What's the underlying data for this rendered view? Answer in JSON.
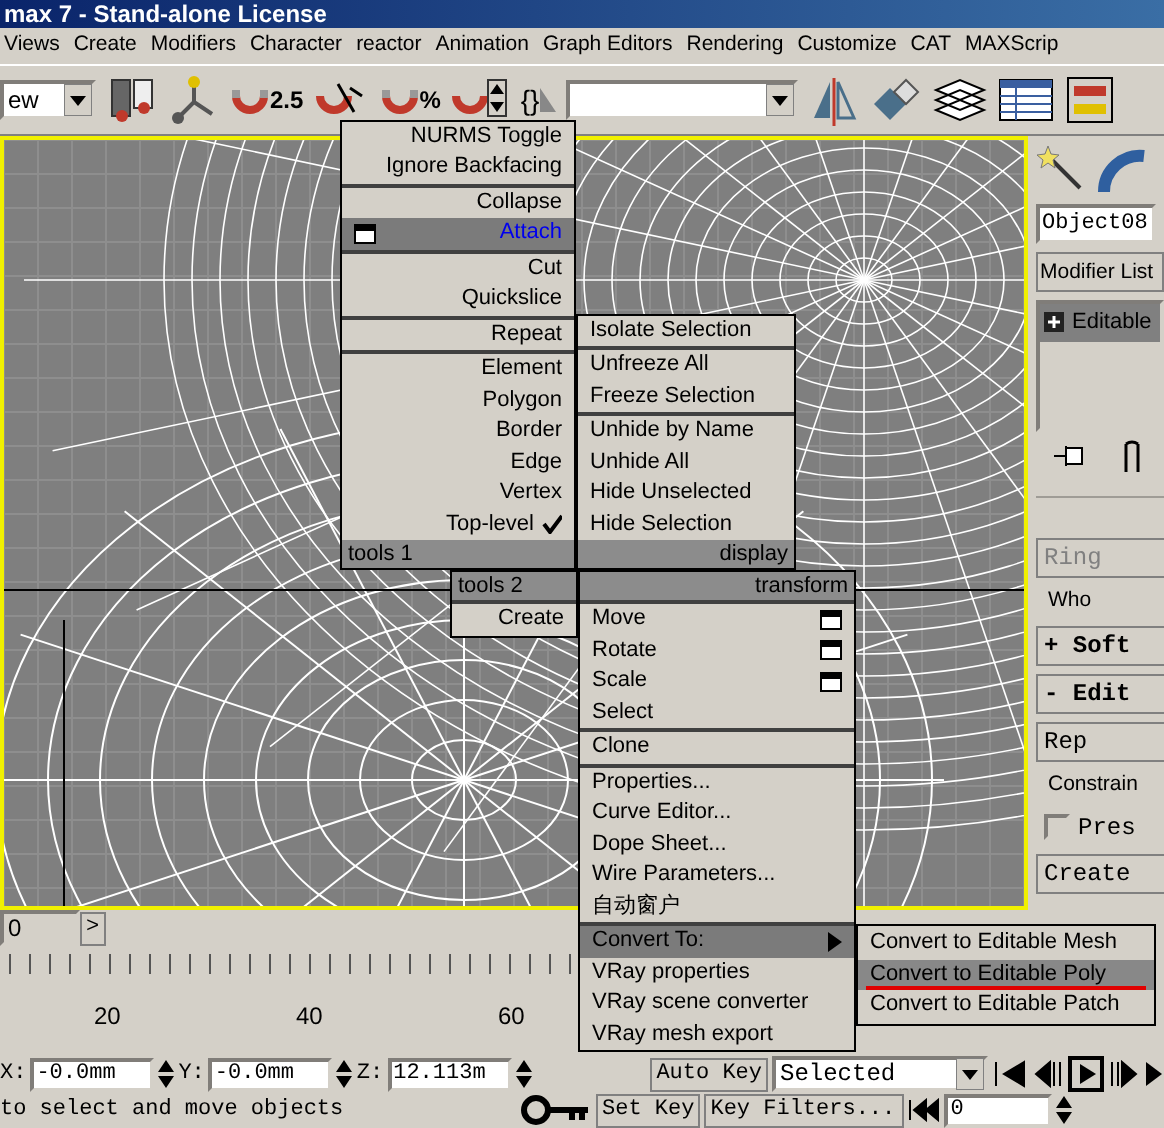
{
  "window": {
    "title": "max 7  - Stand-alone License"
  },
  "menu_bar": [
    "Views",
    "Create",
    "Modifiers",
    "Character",
    "reactor",
    "Animation",
    "Graph Editors",
    "Rendering",
    "Customize",
    "CAT",
    "MAXScrip"
  ],
  "toolbar": [
    {
      "kind": "dropdown",
      "value": "ew"
    },
    {
      "kind": "link"
    },
    {
      "kind": "axis"
    },
    {
      "kind": "snap",
      "label": "2.5"
    },
    {
      "kind": "angle-snap"
    },
    {
      "kind": "snap",
      "label": "%"
    },
    {
      "kind": "spinner-snap"
    },
    {
      "kind": "sets",
      "label": "{}"
    },
    {
      "kind": "combo"
    },
    {
      "kind": "mirror"
    },
    {
      "kind": "align"
    },
    {
      "kind": "layers"
    },
    {
      "kind": "table"
    },
    {
      "kind": "schematic"
    }
  ],
  "command_panel": {
    "tabs": [
      {
        "kind": "create"
      },
      {
        "kind": "modify"
      }
    ],
    "object_name": "Object08",
    "modifier_list": "Modifier List",
    "stack": [
      {
        "label": "Editable",
        "selected": true
      }
    ],
    "controls": [
      {
        "kind": "button",
        "label": "Ring",
        "disabled": true
      },
      {
        "kind": "text",
        "label": "Who"
      },
      {
        "kind": "rollout",
        "sign": "+",
        "label": "Soft"
      },
      {
        "kind": "rollout",
        "sign": "-",
        "label": "Edit"
      },
      {
        "kind": "button",
        "label": "Rep",
        "disabled": false
      },
      {
        "kind": "text",
        "label": "Constrain"
      },
      {
        "kind": "checkbox",
        "label": "Pres",
        "checked": false
      },
      {
        "kind": "button",
        "label": "Create",
        "disabled": false
      }
    ]
  },
  "time_slider": {
    "value": "0",
    "next": ">"
  },
  "ruler": {
    "labels": [
      "20",
      "40",
      "60"
    ]
  },
  "coordinates": [
    {
      "axis": "X:",
      "value": "-0.0mm"
    },
    {
      "axis": "Y:",
      "value": "-0.0mm"
    },
    {
      "axis": "Z:",
      "value": "12.113m"
    }
  ],
  "animation": {
    "auto_key": "Auto Key",
    "key_mode": "Selected",
    "set_key": "Set Key",
    "key_filters": "Key Filters...",
    "frame": "0"
  },
  "prompt": "to select and move objects",
  "quad_menu": {
    "quadrants": [
      {
        "title": "tools 1",
        "groups": [
          [
            {
              "label": "NURMS Toggle",
              "kind": "plain",
              "selected": false,
              "checked": false
            },
            {
              "label": "Ignore Backfacing",
              "kind": "plain",
              "selected": false,
              "checked": false
            }
          ],
          [
            {
              "label": "Collapse",
              "kind": "plain",
              "selected": false,
              "checked": false
            },
            {
              "label": "Attach",
              "kind": "options",
              "selected": true,
              "checked": false
            }
          ],
          [
            {
              "label": "Cut",
              "kind": "plain",
              "selected": false,
              "checked": false
            },
            {
              "label": "Quickslice",
              "kind": "plain",
              "selected": false,
              "checked": false
            }
          ],
          [
            {
              "label": "Repeat",
              "kind": "plain",
              "selected": false,
              "checked": false
            }
          ],
          [
            {
              "label": "Element",
              "kind": "plain",
              "selected": false,
              "checked": false
            },
            {
              "label": "Polygon",
              "kind": "plain",
              "selected": false,
              "checked": false
            },
            {
              "label": "Border",
              "kind": "plain",
              "selected": false,
              "checked": false
            },
            {
              "label": "Edge",
              "kind": "plain",
              "selected": false,
              "checked": false
            },
            {
              "label": "Vertex",
              "kind": "plain",
              "selected": false,
              "checked": false
            },
            {
              "label": "Top-level",
              "kind": "plain",
              "selected": false,
              "checked": true
            }
          ]
        ]
      },
      {
        "title": "display",
        "groups": [
          [
            {
              "label": "Isolate Selection",
              "kind": "plain",
              "selected": false,
              "checked": false
            }
          ],
          [
            {
              "label": "Unfreeze All",
              "kind": "plain",
              "selected": false,
              "checked": false
            },
            {
              "label": "Freeze Selection",
              "kind": "plain",
              "selected": false,
              "checked": false
            }
          ],
          [
            {
              "label": "Unhide by Name",
              "kind": "plain",
              "selected": false,
              "checked": false
            },
            {
              "label": "Unhide All",
              "kind": "plain",
              "selected": false,
              "checked": false
            },
            {
              "label": "Hide Unselected",
              "kind": "plain",
              "selected": false,
              "checked": false
            },
            {
              "label": "Hide Selection",
              "kind": "plain",
              "selected": false,
              "checked": false
            }
          ]
        ]
      },
      {
        "title": "tools 2",
        "groups": [
          [
            {
              "label": "Create",
              "kind": "plain",
              "selected": false,
              "checked": false
            }
          ]
        ]
      },
      {
        "title": "transform",
        "groups": [
          [
            {
              "label": "Move",
              "kind": "options",
              "selected": false,
              "checked": false
            },
            {
              "label": "Rotate",
              "kind": "options",
              "selected": false,
              "checked": false
            },
            {
              "label": "Scale",
              "kind": "options",
              "selected": false,
              "checked": false
            },
            {
              "label": "Select",
              "kind": "plain",
              "selected": false,
              "checked": false
            }
          ],
          [
            {
              "label": "Clone",
              "kind": "plain",
              "selected": false,
              "checked": false
            }
          ],
          [
            {
              "label": "Properties...",
              "kind": "plain",
              "selected": false,
              "checked": false
            },
            {
              "label": "Curve Editor...",
              "kind": "plain",
              "selected": false,
              "checked": false
            },
            {
              "label": "Dope Sheet...",
              "kind": "plain",
              "selected": false,
              "checked": false
            },
            {
              "label": "Wire Parameters...",
              "kind": "plain",
              "selected": false,
              "checked": false
            },
            {
              "label": "自动窗户",
              "kind": "plain",
              "selected": false,
              "checked": false
            }
          ],
          [
            {
              "label": "Convert To:",
              "kind": "submenu",
              "selected": false,
              "checked": false,
              "expanded": true
            },
            {
              "label": "VRay properties",
              "kind": "plain",
              "selected": false,
              "checked": false
            },
            {
              "label": "VRay scene converter",
              "kind": "plain",
              "selected": false,
              "checked": false
            },
            {
              "label": "VRay mesh export",
              "kind": "plain",
              "selected": false,
              "checked": false
            }
          ]
        ]
      }
    ],
    "submenu": [
      {
        "label": "Convert to Editable Mesh",
        "selected": false,
        "marked": false
      },
      {
        "label": "Convert to Editable Poly",
        "selected": true,
        "marked": true
      },
      {
        "label": "Convert to Editable Patch",
        "selected": false,
        "marked": false
      }
    ]
  }
}
